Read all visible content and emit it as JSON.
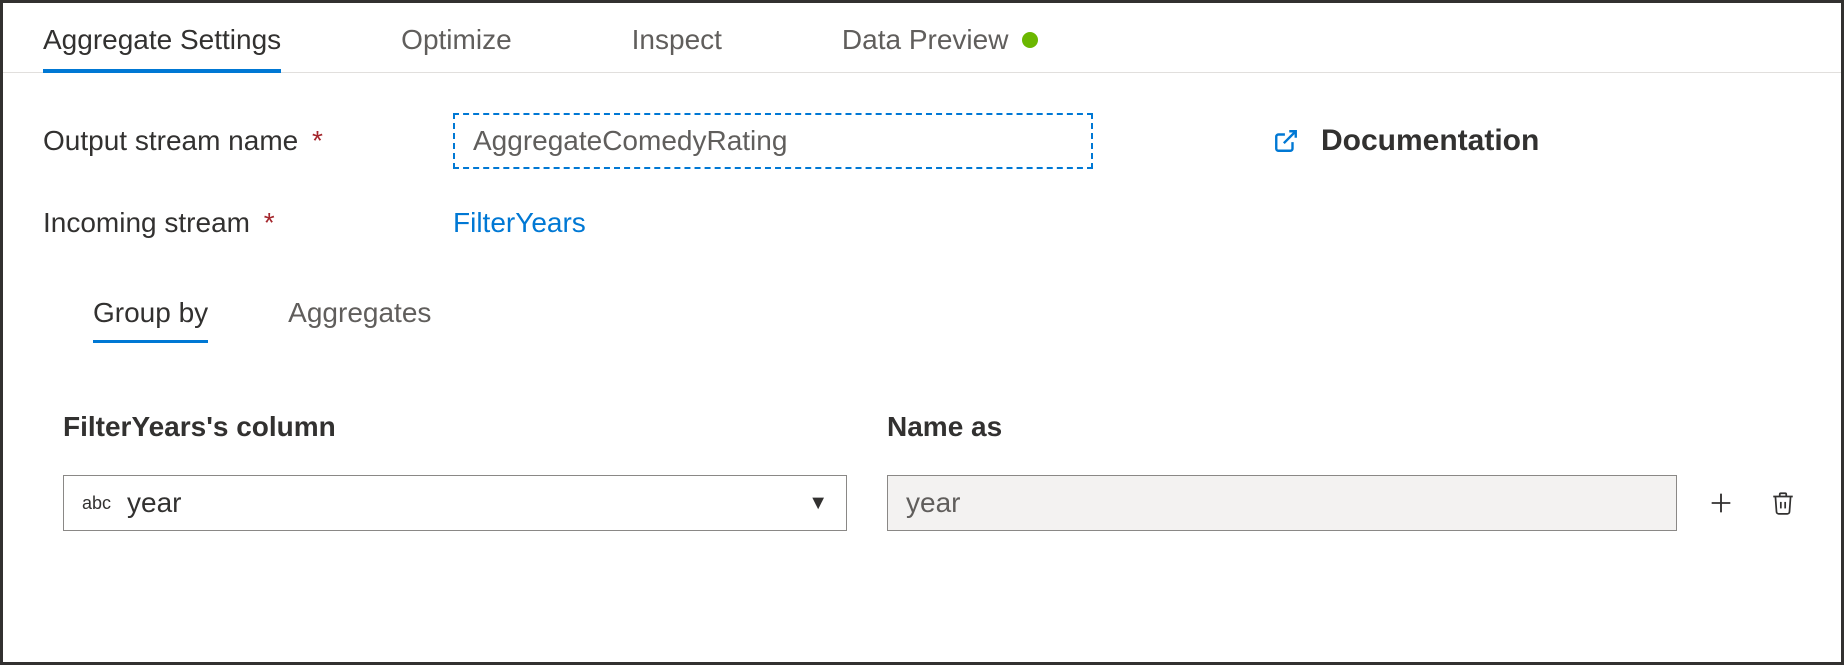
{
  "tabs": {
    "aggregate_settings": "Aggregate Settings",
    "optimize": "Optimize",
    "inspect": "Inspect",
    "data_preview": "Data Preview"
  },
  "form": {
    "output_stream_label": "Output stream name",
    "output_stream_value": "AggregateComedyRating",
    "incoming_stream_label": "Incoming stream",
    "incoming_stream_value": "FilterYears"
  },
  "doc_link": "Documentation",
  "sub_tabs": {
    "group_by": "Group by",
    "aggregates": "Aggregates"
  },
  "columns": {
    "left_header": "FilterYears's column",
    "right_header": "Name as",
    "type_tag": "abc",
    "column_value": "year",
    "name_as_value": "year"
  }
}
